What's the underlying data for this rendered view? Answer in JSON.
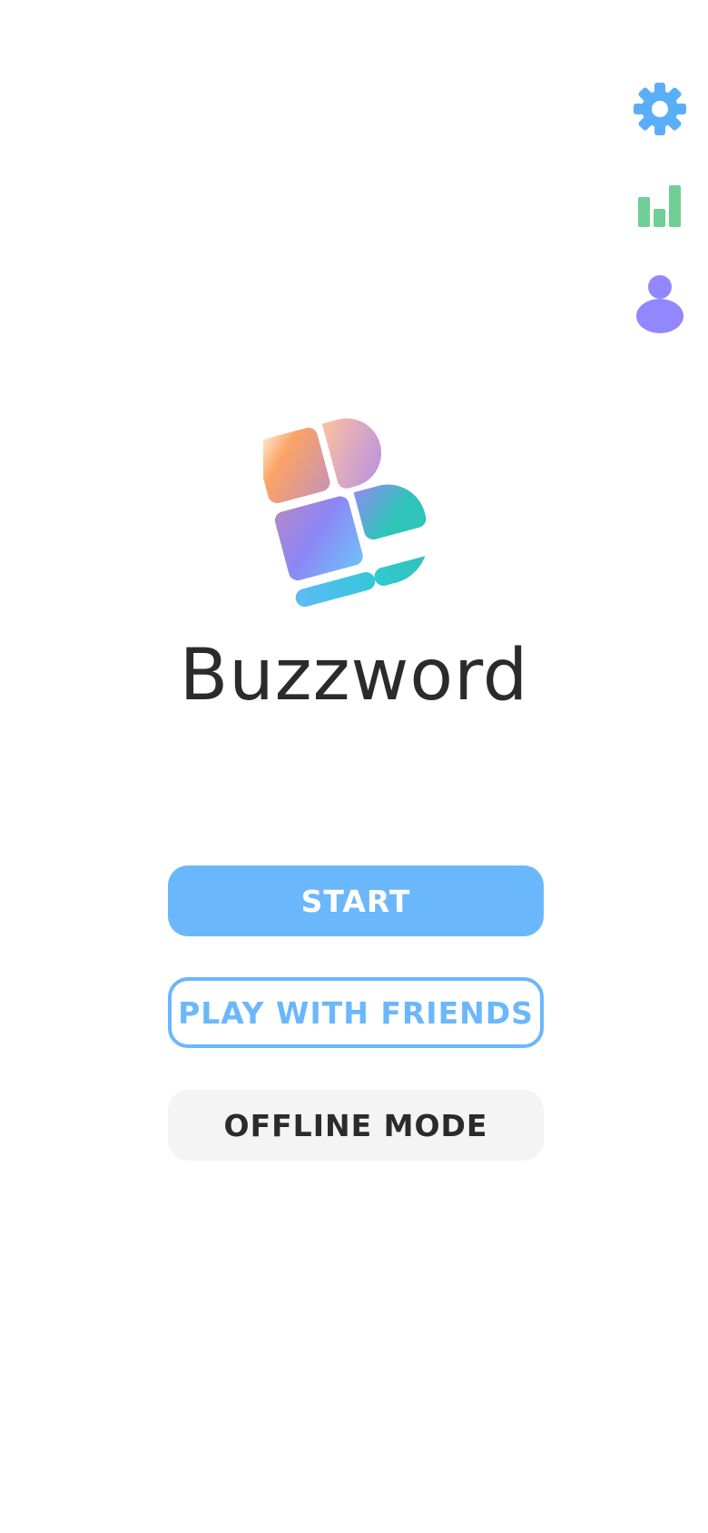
{
  "app": {
    "title": "Buzzword"
  },
  "top_icons": [
    {
      "name": "settings",
      "icon": "gear-icon",
      "color": "#5aaef8"
    },
    {
      "name": "statistics",
      "icon": "bar-chart-icon",
      "color": "#6fcf97"
    },
    {
      "name": "profile",
      "icon": "person-icon",
      "color": "#9287ff"
    }
  ],
  "menu": {
    "start_label": "START",
    "friends_label": "PLAY WITH FRIENDS",
    "offline_label": "OFFLINE MODE"
  },
  "colors": {
    "primary": "#6bb7fc",
    "text_dark": "#2b2b2b",
    "secondary_bg": "#f4f4f4"
  }
}
